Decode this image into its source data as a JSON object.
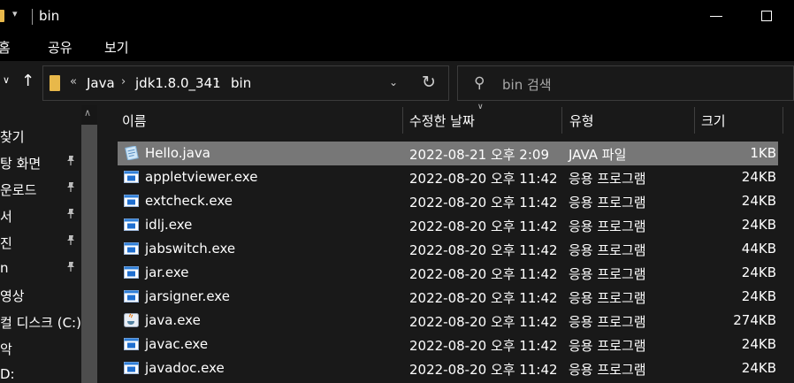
{
  "window": {
    "title": "bin",
    "quick_access_glyph": "▾",
    "folder_icon_color": "#e8b84a"
  },
  "ribbon": {
    "tabs": [
      "홈",
      "공유",
      "보기"
    ]
  },
  "address": {
    "overflow": "«",
    "path": [
      "Java",
      "jdk1.8.0_341",
      "bin"
    ],
    "chevron": "›",
    "dropdown_glyph": "⌄",
    "refresh_glyph": "↻"
  },
  "search": {
    "placeholder": "bin 검색"
  },
  "navpane": {
    "items": [
      {
        "label": "찾기",
        "pinned": false
      },
      {
        "label": "탕 화면",
        "pinned": true
      },
      {
        "label": "운로드",
        "pinned": true
      },
      {
        "label": "서",
        "pinned": true
      },
      {
        "label": "진",
        "pinned": true
      },
      {
        "label": "n",
        "pinned": true
      },
      {
        "label": "영상",
        "pinned": false
      },
      {
        "label": "컬 디스크 (C:)",
        "pinned": false
      },
      {
        "label": "악",
        "pinned": false
      },
      {
        "label": "D:",
        "pinned": false
      }
    ],
    "pin_glyph": "📌"
  },
  "columns": {
    "name": "이름",
    "date": "수정한 날짜",
    "type": "유형",
    "size": "크기"
  },
  "files": [
    {
      "name": "Hello.java",
      "date": "2022-08-21 오후 2:09",
      "type": "JAVA 파일",
      "size": "1KB",
      "icon": "java-file-icon",
      "selected": true
    },
    {
      "name": "appletviewer.exe",
      "date": "2022-08-20 오후 11:42",
      "type": "응용 프로그램",
      "size": "24KB",
      "icon": "exe-icon",
      "selected": false
    },
    {
      "name": "extcheck.exe",
      "date": "2022-08-20 오후 11:42",
      "type": "응용 프로그램",
      "size": "24KB",
      "icon": "exe-icon",
      "selected": false
    },
    {
      "name": "idlj.exe",
      "date": "2022-08-20 오후 11:42",
      "type": "응용 프로그램",
      "size": "24KB",
      "icon": "exe-icon",
      "selected": false
    },
    {
      "name": "jabswitch.exe",
      "date": "2022-08-20 오후 11:42",
      "type": "응용 프로그램",
      "size": "44KB",
      "icon": "exe-icon",
      "selected": false
    },
    {
      "name": "jar.exe",
      "date": "2022-08-20 오후 11:42",
      "type": "응용 프로그램",
      "size": "24KB",
      "icon": "exe-icon",
      "selected": false
    },
    {
      "name": "jarsigner.exe",
      "date": "2022-08-20 오후 11:42",
      "type": "응용 프로그램",
      "size": "24KB",
      "icon": "exe-icon",
      "selected": false
    },
    {
      "name": "java.exe",
      "date": "2022-08-20 오후 11:42",
      "type": "응용 프로그램",
      "size": "274KB",
      "icon": "java-exe-icon",
      "selected": false
    },
    {
      "name": "javac.exe",
      "date": "2022-08-20 오후 11:42",
      "type": "응용 프로그램",
      "size": "24KB",
      "icon": "exe-icon",
      "selected": false
    },
    {
      "name": "javadoc.exe",
      "date": "2022-08-20 오후 11:42",
      "type": "응용 프로그램",
      "size": "24KB",
      "icon": "exe-icon",
      "selected": false
    }
  ],
  "colors": {
    "background": "#191919",
    "titlebar": "#000000",
    "selection": "#777777",
    "exe_icon_blue": "#1f6fd0"
  }
}
